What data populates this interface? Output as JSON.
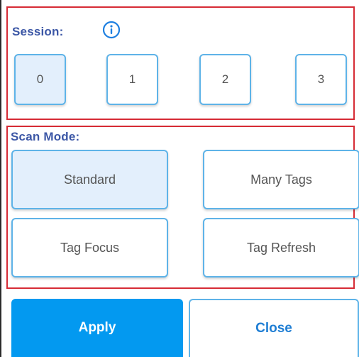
{
  "session": {
    "label": "Session:",
    "info_icon": "info-icon",
    "options": [
      "0",
      "1",
      "2",
      "3"
    ],
    "selected": "0"
  },
  "scan_mode": {
    "label": "Scan Mode:",
    "options": [
      "Standard",
      "Many Tags",
      "Tag Focus",
      "Tag Refresh"
    ],
    "selected": "Standard"
  },
  "actions": {
    "apply_label": "Apply",
    "close_label": "Close"
  },
  "colors": {
    "highlight_border": "#d62b35",
    "label_text": "#3c57a6",
    "button_border": "#5eb3e8",
    "selected_fill": "#e3effc",
    "primary": "#0399f0",
    "close_text": "#1f7ed4"
  }
}
